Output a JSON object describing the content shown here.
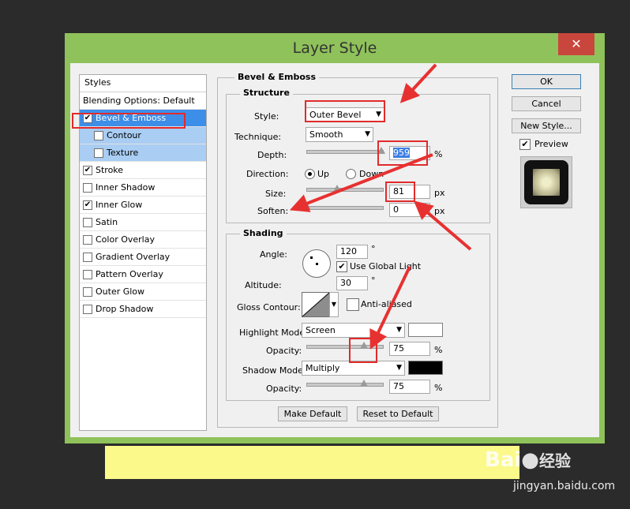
{
  "dialog": {
    "title": "Layer Style",
    "close_glyph": "✕"
  },
  "styles_panel": {
    "header": "Styles",
    "items": [
      {
        "label": "Blending Options: Default",
        "checkbox": false,
        "checked": false,
        "selected": false
      },
      {
        "label": "Bevel & Emboss",
        "checkbox": true,
        "checked": true,
        "selected": true
      },
      {
        "label": "Contour",
        "checkbox": true,
        "checked": false,
        "sub": true
      },
      {
        "label": "Texture",
        "checkbox": true,
        "checked": false,
        "sub": true
      },
      {
        "label": "Stroke",
        "checkbox": true,
        "checked": true
      },
      {
        "label": "Inner Shadow",
        "checkbox": true,
        "checked": false
      },
      {
        "label": "Inner Glow",
        "checkbox": true,
        "checked": true
      },
      {
        "label": "Satin",
        "checkbox": true,
        "checked": false
      },
      {
        "label": "Color Overlay",
        "checkbox": true,
        "checked": false
      },
      {
        "label": "Gradient Overlay",
        "checkbox": true,
        "checked": false
      },
      {
        "label": "Pattern Overlay",
        "checkbox": true,
        "checked": false
      },
      {
        "label": "Outer Glow",
        "checkbox": true,
        "checked": false
      },
      {
        "label": "Drop Shadow",
        "checkbox": true,
        "checked": false
      }
    ]
  },
  "bevel": {
    "group_title": "Bevel & Emboss",
    "structure_title": "Structure",
    "style_label": "Style:",
    "style_value": "Outer Bevel",
    "technique_label": "Technique:",
    "technique_value": "Smooth",
    "depth_label": "Depth:",
    "depth_value": "959",
    "depth_unit": "%",
    "direction_label": "Direction:",
    "dir_up": "Up",
    "dir_down": "Down",
    "size_label": "Size:",
    "size_value": "81",
    "size_unit": "px",
    "soften_label": "Soften:",
    "soften_value": "0",
    "soften_unit": "px",
    "shading_title": "Shading",
    "angle_label": "Angle:",
    "angle_value": "120",
    "degree": "°",
    "global_light": "Use Global Light",
    "altitude_label": "Altitude:",
    "altitude_value": "30",
    "gloss_label": "Gloss Contour:",
    "anti_aliased": "Anti-aliased",
    "highlight_label": "Highlight Mode:",
    "highlight_value": "Screen",
    "highlight_color": "#ffffff",
    "opacity_label": "Opacity:",
    "highlight_opacity": "75",
    "shadow_label": "Shadow Mode:",
    "shadow_value": "Multiply",
    "shadow_color": "#000000",
    "shadow_opacity": "75",
    "pct": "%",
    "make_default": "Make Default",
    "reset_default": "Reset to Default"
  },
  "side": {
    "ok": "OK",
    "cancel": "Cancel",
    "new_style": "New Style...",
    "preview": "Preview"
  },
  "watermark": {
    "brand": "Bai",
    "brand_cn": "经验",
    "url": "jingyan.baidu.com"
  },
  "colors": {
    "frame": "#8fc25a",
    "selection": "#3d8ee9",
    "highlight_box": "#e12b2b"
  }
}
